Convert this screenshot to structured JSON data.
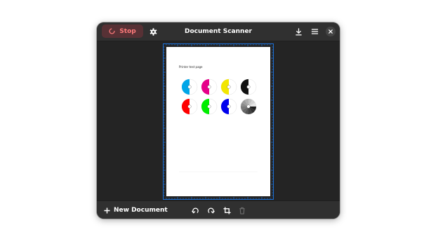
{
  "window": {
    "title": "Document Scanner"
  },
  "header": {
    "stop_label": "Stop",
    "icons": [
      "spinner-icon",
      "gear-icon",
      "download-icon",
      "hamburger-menu-icon",
      "close-icon"
    ]
  },
  "page": {
    "label": "Printer test page",
    "circle_colors": [
      "#00a6e8",
      "#e6008a",
      "#f2e600",
      "#111111",
      "#ff0000",
      "#00ee00",
      "#0000ee",
      "#777777"
    ],
    "accent": "#1c71d8"
  },
  "footer": {
    "new_document_label": "New Document",
    "icons": [
      "plus-icon",
      "rotate-left-icon",
      "rotate-right-icon",
      "crop-icon",
      "trash-icon"
    ]
  },
  "colors": {
    "window_bg": "#242424",
    "headerbar_bg": "#303030",
    "stop_bg": "#573135",
    "stop_fg": "#ff7b7b"
  }
}
